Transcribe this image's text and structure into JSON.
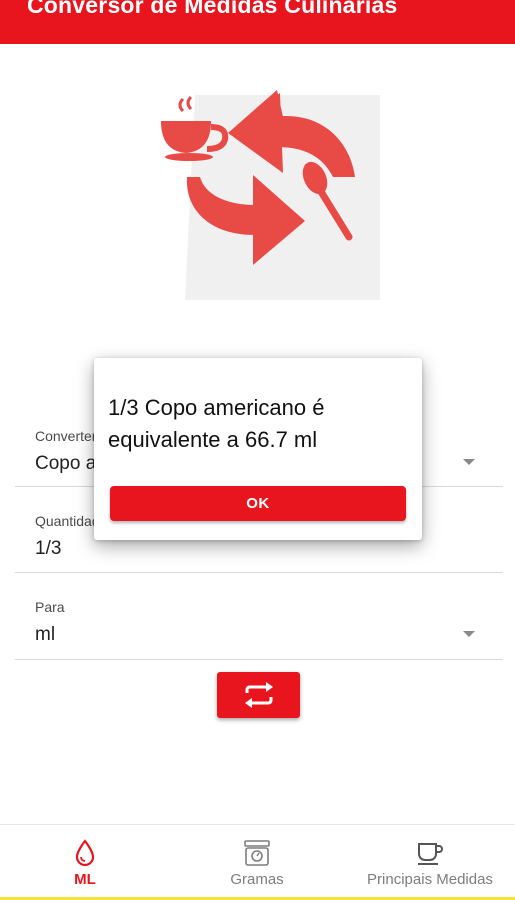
{
  "app": {
    "title": "Conversor de Medidas Culinárias",
    "accent_color": "#e8141e",
    "logo_icons": [
      "cup-icon",
      "arrows-icon",
      "spoon-icon"
    ]
  },
  "form": {
    "from": {
      "label": "Converter",
      "value": "Copo a",
      "icon": "dropdown-arrow-icon"
    },
    "quantity": {
      "label": "Quantidade",
      "value": "1/3"
    },
    "to": {
      "label": "Para",
      "value": "ml",
      "icon": "dropdown-arrow-icon"
    },
    "swap_icon": "swap-icon"
  },
  "dialog": {
    "message": "1/3 Copo americano é equivalente a 66.7 ml",
    "ok_label": "OK"
  },
  "bottom_nav": {
    "items": [
      {
        "label": "ML",
        "icon": "drop-icon",
        "active": true
      },
      {
        "label": "Gramas",
        "icon": "scale-icon",
        "active": false
      },
      {
        "label": "Principais Medidas",
        "icon": "cup-icon",
        "active": false
      }
    ]
  }
}
